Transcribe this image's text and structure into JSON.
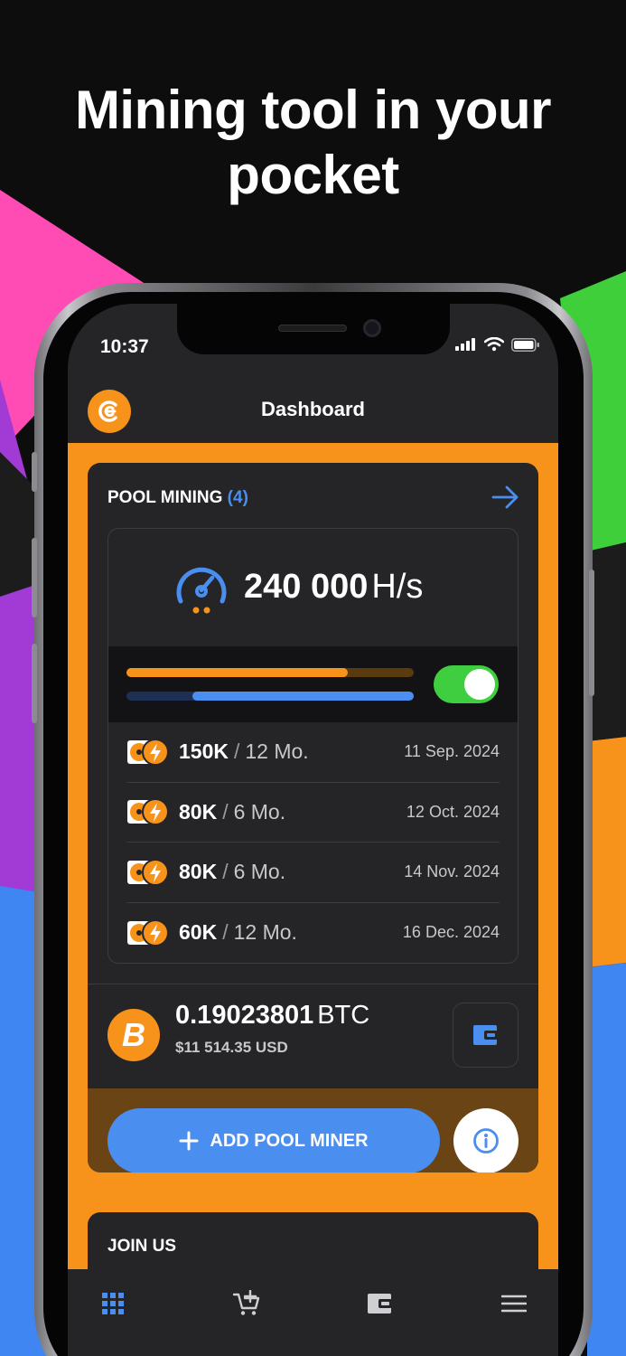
{
  "headline": {
    "line1": "Mining tool in your",
    "line2": "pocket"
  },
  "colors": {
    "accent_orange": "#f7931a",
    "accent_blue": "#4a8ef0",
    "toggle_green": "#3fce3f",
    "bg_pink": "#ff4bb4",
    "bg_purple": "#a23ad6",
    "bg_green": "#3ecf3a",
    "bg_blue": "#3f86f2"
  },
  "status_bar": {
    "time": "10:37",
    "icons": [
      "signal-icon",
      "wifi-icon",
      "battery-icon"
    ]
  },
  "header": {
    "title": "Dashboard",
    "logo_icon": "app-logo-icon"
  },
  "pool_mining": {
    "title": "POOL MINING",
    "count": "(4)",
    "hashrate_value": "240 000",
    "hashrate_unit": "H/s",
    "progress": {
      "orange_fraction": 0.77,
      "blue_start_fraction": 0.23,
      "blue_end_fraction": 1.0
    },
    "toggle_on": true,
    "miners": [
      {
        "amount": "150K",
        "sep": "/",
        "term": "12 Mo.",
        "date": "11 Sep. 2024"
      },
      {
        "amount": "80K",
        "sep": "/",
        "term": "6 Mo.",
        "date": "12 Oct. 2024"
      },
      {
        "amount": "80K",
        "sep": "/",
        "term": "6 Mo.",
        "date": "14 Nov. 2024"
      },
      {
        "amount": "60K",
        "sep": "/",
        "term": "12 Mo.",
        "date": "16 Dec. 2024"
      }
    ]
  },
  "balance": {
    "btc_amount": "0.19023801",
    "btc_unit": "BTC",
    "usd": "$11 514.35 USD",
    "btc_symbol": "B"
  },
  "actions": {
    "add_label": "ADD POOL MINER",
    "add_icon": "plus-icon",
    "info_icon": "info-icon"
  },
  "join": {
    "title": "JOIN US"
  },
  "tab_bar": [
    "grid-icon",
    "cart-add-icon",
    "wallet-icon",
    "menu-icon"
  ]
}
